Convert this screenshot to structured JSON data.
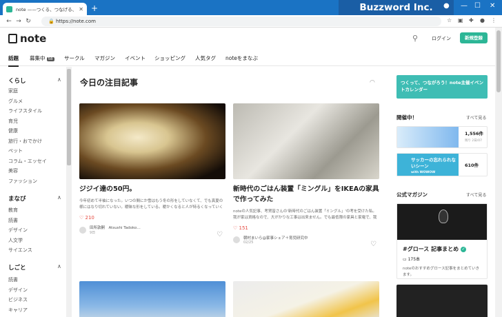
{
  "browser": {
    "tab_title": "note ——つくる、つなげる、とどける。",
    "url": "https://note.com",
    "watermark": "Buzzword Inc."
  },
  "header": {
    "logo": "note",
    "login": "ログイン",
    "signup": "新規登録"
  },
  "nav": [
    {
      "label": "話題"
    },
    {
      "label": "募集中",
      "badge": "58"
    },
    {
      "label": "サークル"
    },
    {
      "label": "マガジン"
    },
    {
      "label": "イベント"
    },
    {
      "label": "ショッピング"
    },
    {
      "label": "人気タグ"
    },
    {
      "label": "noteをまなぶ"
    }
  ],
  "sidebar": {
    "sections": [
      {
        "title": "くらし",
        "items": [
          "家庭",
          "グルメ",
          "ライフスタイル",
          "育児",
          "健康",
          "旅行・おでかけ",
          "ペット",
          "コラム・エッセイ",
          "美容",
          "ファッション"
        ]
      },
      {
        "title": "まなび",
        "items": [
          "教育",
          "読書",
          "デザイン",
          "人文学",
          "サイエンス"
        ]
      },
      {
        "title": "しごと",
        "items": [
          "読書",
          "デザイン",
          "ビジネス",
          "キャリア"
        ]
      }
    ]
  },
  "main": {
    "title": "今日の注目記事",
    "articles": [
      {
        "title": "ジジイ達の50円。",
        "excerpt": "今年初めて半袖になった。いつの間にか雪はもう冬の形をしていなくて、でも真夏の様にはなり切れていない。曖昧な形をしている。曖かくなると人が特るくなっていく気がする。浮かれて陽気な気分の時ほどいうように、基…",
        "likes": "210",
        "author": "田所敦嗣　Atsushi Tadoko…",
        "date": "9日"
      },
      {
        "title": "新時代のごはん装置「ミングル」をIKEAの家具で作ってみた",
        "excerpt": "noteの人気記事、考賀皆さんの'新時代のごはん装置「ミングル」'の考を受けた私。 我が家は資格なので、大がかりな工事は出来ません。でも最低限の家具と家電で、我がまなりにミングルの考えを取り入れようと決心…",
        "likes": "151",
        "author": "朝村まいら@家事シェア＋育児研究中",
        "date": "02/25"
      }
    ]
  },
  "right": {
    "banner": "つくって、つながろう！note主催イベントカレンダー",
    "events_title": "開催中！",
    "more": "すべて見る",
    "events": [
      {
        "count": "1,556件",
        "sub": "残り 2日/07"
      },
      {
        "title": "サッカーの忘れられないシーン",
        "sponsor": "with WOWOW",
        "count": "610件"
      }
    ],
    "magazine_title": "公式マガジン",
    "magazine": {
      "title": "#グロース 記事まとめ",
      "count": "175本",
      "desc": "noteのおすすめグロース記事をまとめていきます。"
    }
  },
  "colors": {
    "accent": "#2cb696",
    "chrome": "#1a73c4",
    "like": "#e5493f"
  }
}
